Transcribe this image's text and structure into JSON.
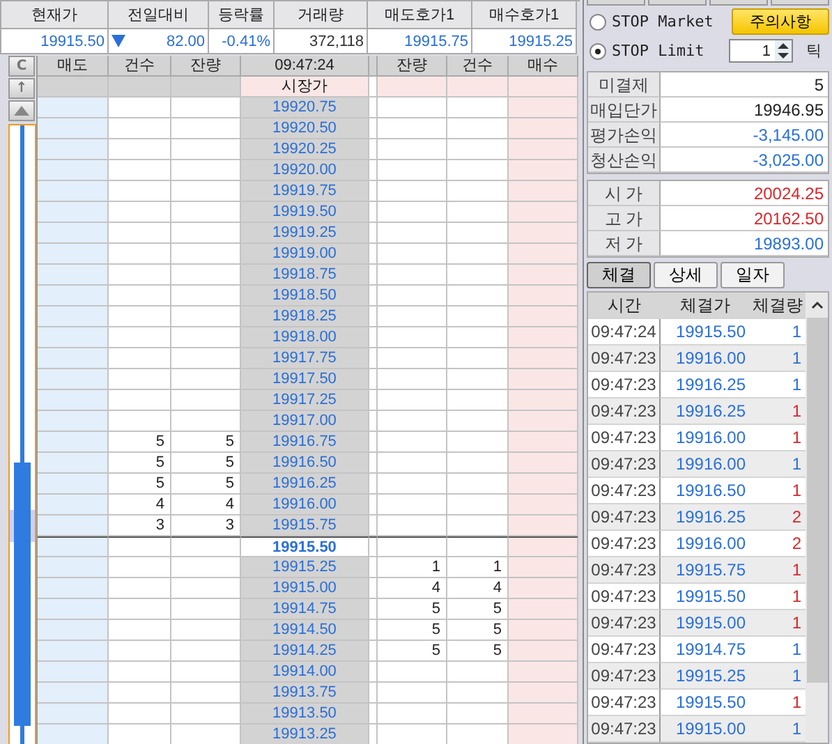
{
  "quote": [
    {
      "label": "현재가",
      "value": "19915.50",
      "color": "#2a6fd8"
    },
    {
      "label": "전일대비",
      "value": "82.00",
      "color": "#2a6fd8",
      "falling": true
    },
    {
      "label": "등락률",
      "value": "-0.41%",
      "color": "#2a6fd8"
    },
    {
      "label": "거래량",
      "value": "372,118",
      "color": "#333333"
    },
    {
      "label": "매도호가1",
      "value": "19915.75",
      "color": "#2a6fd8"
    },
    {
      "label": "매수호가1",
      "value": "19915.25",
      "color": "#2a6fd8"
    }
  ],
  "ladder": {
    "clear_button": "C",
    "up_button": "↑",
    "columns": [
      "매도",
      "건수",
      "잔량",
      "09:47:24",
      "잔량",
      "건수",
      "매수"
    ],
    "market_label": "시장가",
    "rows": [
      {
        "price": "19920.75",
        "current": false
      },
      {
        "price": "19920.50",
        "current": false
      },
      {
        "price": "19920.25",
        "current": false
      },
      {
        "price": "19920.00",
        "current": false
      },
      {
        "price": "19919.75",
        "current": false
      },
      {
        "price": "19919.50",
        "current": false
      },
      {
        "price": "19919.25",
        "current": false
      },
      {
        "price": "19919.00",
        "current": false
      },
      {
        "price": "19918.75",
        "current": false
      },
      {
        "price": "19918.50",
        "current": false
      },
      {
        "price": "19918.25",
        "current": false
      },
      {
        "price": "19918.00",
        "current": false
      },
      {
        "price": "19917.75",
        "current": false
      },
      {
        "price": "19917.50",
        "current": false
      },
      {
        "price": "19917.25",
        "current": false
      },
      {
        "price": "19917.00",
        "current": false
      },
      {
        "price": "19916.75",
        "current": false,
        "ask_count": "5",
        "ask_qty": "5"
      },
      {
        "price": "19916.50",
        "current": false,
        "ask_count": "5",
        "ask_qty": "5"
      },
      {
        "price": "19916.25",
        "current": false,
        "ask_count": "5",
        "ask_qty": "5"
      },
      {
        "price": "19916.00",
        "current": false,
        "ask_count": "4",
        "ask_qty": "4"
      },
      {
        "price": "19915.75",
        "current": false,
        "ask_count": "3",
        "ask_qty": "3"
      },
      {
        "price": "19915.50",
        "current": true
      },
      {
        "price": "19915.25",
        "current": false,
        "bid_qty": "1",
        "bid_count": "1"
      },
      {
        "price": "19915.00",
        "current": false,
        "bid_qty": "4",
        "bid_count": "4"
      },
      {
        "price": "19914.75",
        "current": false,
        "bid_qty": "5",
        "bid_count": "5"
      },
      {
        "price": "19914.50",
        "current": false,
        "bid_qty": "5",
        "bid_count": "5"
      },
      {
        "price": "19914.25",
        "current": false,
        "bid_qty": "5",
        "bid_count": "5"
      },
      {
        "price": "19914.00",
        "current": false
      },
      {
        "price": "19913.75",
        "current": false
      },
      {
        "price": "19913.50",
        "current": false
      },
      {
        "price": "19913.25",
        "current": false
      }
    ]
  },
  "panel": {
    "stop_orders": [
      {
        "label": "STOP Market",
        "selected": false
      },
      {
        "label": "STOP Limit",
        "selected": true
      }
    ],
    "notice_button": "주의사항",
    "tick_value": "1",
    "tick_unit": "틱",
    "position": [
      {
        "label": "미결제",
        "value": "5",
        "color": "#222222"
      },
      {
        "label": "매입단가",
        "value": "19946.95",
        "color": "#222222"
      },
      {
        "label": "평가손익",
        "value": "-3,145.00",
        "color": "#2a6fd8"
      },
      {
        "label": "청산손익",
        "value": "-3,025.00",
        "color": "#2a6fd8"
      }
    ],
    "prices": [
      {
        "label": "시 가",
        "value": "20024.25",
        "color": "#d8262b"
      },
      {
        "label": "고 가",
        "value": "20162.50",
        "color": "#d8262b"
      },
      {
        "label": "저 가",
        "value": "19893.00",
        "color": "#2a6fd8"
      }
    ],
    "tabs": [
      {
        "label": "체결",
        "selected": true
      },
      {
        "label": "상세",
        "selected": false
      },
      {
        "label": "일자",
        "selected": false
      }
    ],
    "trade_columns": [
      "시간",
      "체결가",
      "체결량"
    ],
    "trades": [
      {
        "time": "09:47:24",
        "price": "19915.50",
        "volume": "1",
        "color": "#2a6fd8"
      },
      {
        "time": "09:47:23",
        "price": "19916.00",
        "volume": "1",
        "color": "#2a6fd8"
      },
      {
        "time": "09:47:23",
        "price": "19916.25",
        "volume": "1",
        "color": "#2a6fd8"
      },
      {
        "time": "09:47:23",
        "price": "19916.25",
        "volume": "1",
        "color": "#d8262b"
      },
      {
        "time": "09:47:23",
        "price": "19916.00",
        "volume": "1",
        "color": "#d8262b"
      },
      {
        "time": "09:47:23",
        "price": "19916.00",
        "volume": "1",
        "color": "#2a6fd8"
      },
      {
        "time": "09:47:23",
        "price": "19916.50",
        "volume": "1",
        "color": "#d8262b"
      },
      {
        "time": "09:47:23",
        "price": "19916.25",
        "volume": "2",
        "color": "#d8262b"
      },
      {
        "time": "09:47:23",
        "price": "19916.00",
        "volume": "2",
        "color": "#d8262b"
      },
      {
        "time": "09:47:23",
        "price": "19915.75",
        "volume": "1",
        "color": "#d8262b"
      },
      {
        "time": "09:47:23",
        "price": "19915.50",
        "volume": "1",
        "color": "#d8262b"
      },
      {
        "time": "09:47:23",
        "price": "19915.00",
        "volume": "1",
        "color": "#d8262b"
      },
      {
        "time": "09:47:23",
        "price": "19914.75",
        "volume": "1",
        "color": "#2a6fd8"
      },
      {
        "time": "09:47:23",
        "price": "19915.25",
        "volume": "1",
        "color": "#2a6fd8"
      },
      {
        "time": "09:47:23",
        "price": "19915.50",
        "volume": "1",
        "color": "#d8262b"
      },
      {
        "time": "09:47:23",
        "price": "19915.00",
        "volume": "1",
        "color": "#2a6fd8"
      }
    ]
  }
}
